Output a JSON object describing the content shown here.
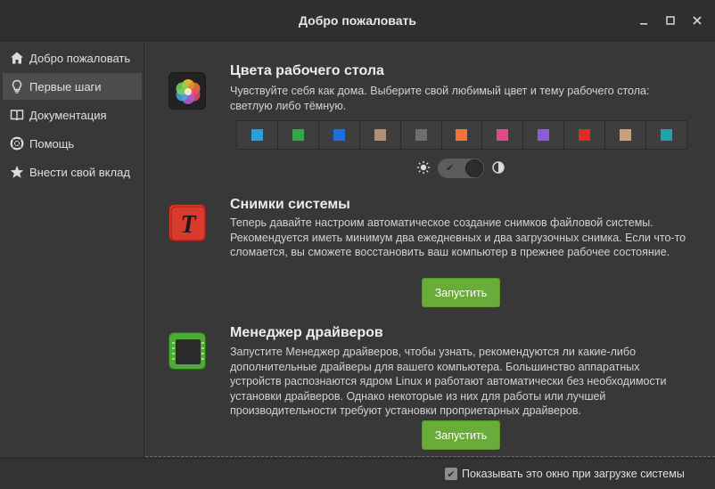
{
  "window": {
    "title": "Добро пожаловать"
  },
  "sidebar": {
    "items": [
      {
        "label": "Добро пожаловать",
        "icon": "home-icon"
      },
      {
        "label": "Первые шаги",
        "icon": "lightbulb-icon"
      },
      {
        "label": "Документация",
        "icon": "book-icon"
      },
      {
        "label": "Помощь",
        "icon": "lifebuoy-icon"
      },
      {
        "label": "Внести свой вклад",
        "icon": "star-icon"
      }
    ],
    "active_index": 1
  },
  "sections": {
    "colors": {
      "title": "Цвета рабочего стола",
      "description": "Чувствуйте себя как дома. Выберите свой любимый цвет и тему рабочего стола: светлую либо тёмную.",
      "swatches": [
        "#2a9fd9",
        "#35a64a",
        "#1f6fd8",
        "#b09074",
        "#6e6e70",
        "#f07436",
        "#e04a86",
        "#8e5bd6",
        "#e02a2a",
        "#c6a27c",
        "#1fa5a5"
      ],
      "theme": "dark"
    },
    "timeshift": {
      "title": "Снимки системы",
      "description": "Теперь давайте настроим автоматическое создание снимков файловой системы. Рекомендуется иметь минимум два ежедневных и два загрузочных снимка. Если что-то сломается, вы сможете восстановить ваш компьютер в прежнее рабочее состояние.",
      "button": "Запустить"
    },
    "drivers": {
      "title": "Менеджер драйверов",
      "description": "Запустите Менеджер драйверов, чтобы узнать, рекомендуются ли какие-либо дополнительные драйверы для вашего компьютера. Большинство аппаратных устройств распознаются ядром Linux и работают автоматически без необходимости установки драйверов. Однако некоторые из них для работы или лучшей производительности требуют установки проприетарных драйверов.",
      "button": "Запустить"
    }
  },
  "footer": {
    "checkbox_label": "Показывать это окно при загрузке системы",
    "checked": true
  },
  "colors": {
    "accent_green": "#6aac3a"
  }
}
